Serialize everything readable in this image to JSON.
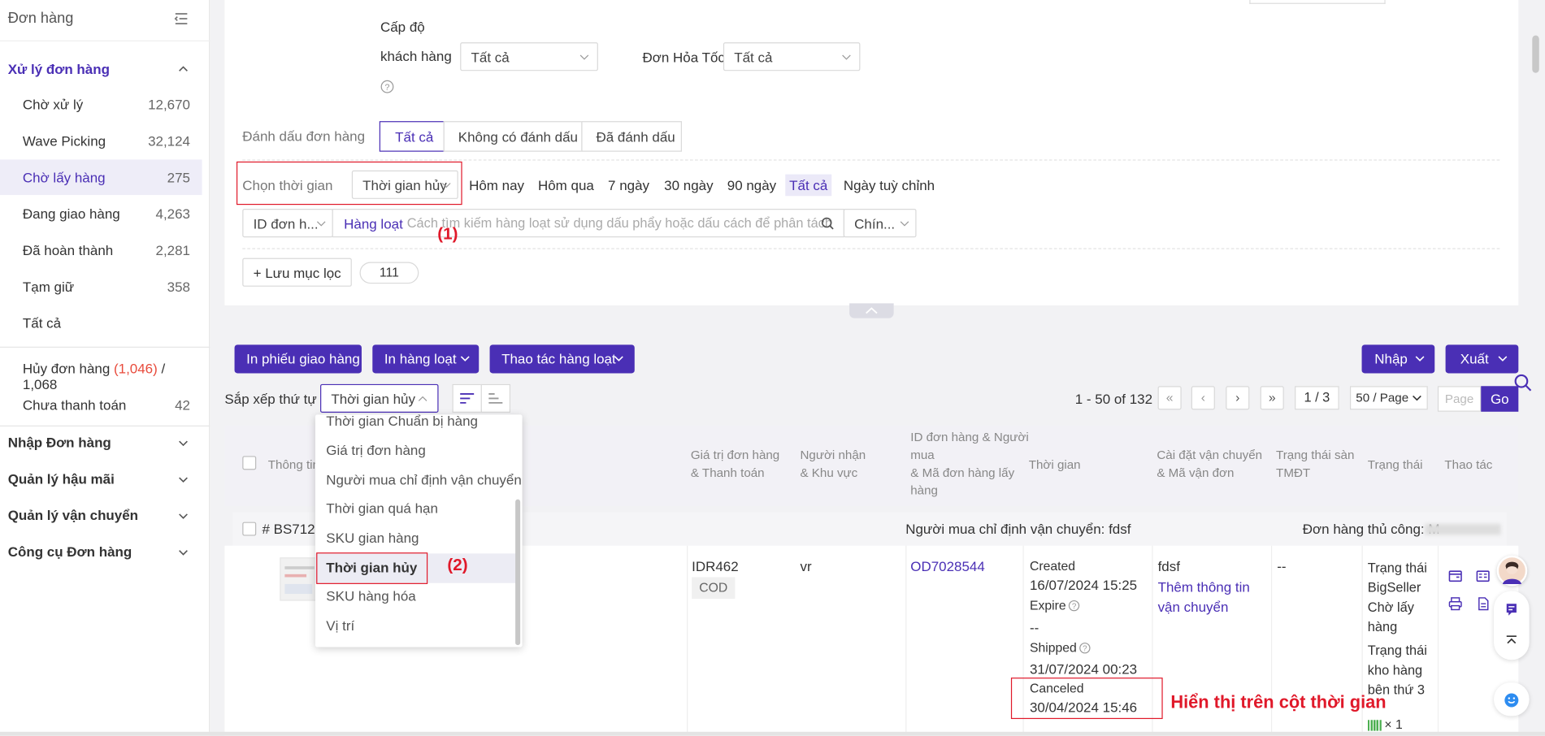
{
  "sidebar": {
    "title": "Đơn hàng",
    "group_process": "Xử lý đơn hàng",
    "items": [
      {
        "label": "Chờ xử lý",
        "count": "12,670"
      },
      {
        "label": "Wave Picking",
        "count": "32,124"
      },
      {
        "label": "Chờ lấy hàng",
        "count": "275"
      },
      {
        "label": "Đang giao hàng",
        "count": "4,263"
      },
      {
        "label": "Đã hoàn thành",
        "count": "2,281"
      },
      {
        "label": "Tạm giữ",
        "count": "358"
      },
      {
        "label": "Tất cả",
        "count": ""
      }
    ],
    "cancel_label": "Hủy đơn hàng",
    "cancel_count_red": "(1,046)",
    "cancel_count_total": "/ 1,068",
    "unpaid_label": "Chưa thanh toán",
    "unpaid_count": "42",
    "groups": [
      "Nhập Đơn hàng",
      "Quản lý hậu mãi",
      "Quản lý vận chuyển",
      "Công cụ Đơn hàng"
    ]
  },
  "filters": {
    "customer_level_line1": "Cấp độ",
    "customer_level_line2": "khách hàng",
    "customer_level_value": "Tất cả",
    "express_label": "Đơn Hỏa Tốc",
    "express_value": "Tất cả",
    "mark_label": "Đánh dấu đơn hàng",
    "mark_options": [
      "Tất cả",
      "Không có đánh dấu",
      "Đã đánh dấu"
    ],
    "time_label": "Chọn thời gian",
    "time_value": "Thời gian hủy",
    "quick_times": [
      "Hôm nay",
      "Hôm qua",
      "7 ngày",
      "30 ngày",
      "90 ngày",
      "Tất cả",
      "Ngày tuỳ chỉnh"
    ],
    "search_type": "ID đơn h...",
    "batch_label": "Hàng loạt",
    "search_placeholder": "Cách tìm kiếm hàng loạt sử dụng dấu phẩy hoặc dấu cách để phân tách",
    "exact_value": "Chín...",
    "save_filter": "+ Lưu mục lọc",
    "saved_tag": "111"
  },
  "annotations": {
    "a1": "(1)",
    "a2": "(2)",
    "a3": "Hiển thị trên cột thời gian"
  },
  "actions": {
    "print_delivery": "In phiếu giao hàng",
    "bulk_print": "In hàng loạt",
    "bulk_ops": "Thao tác hàng loạt",
    "import": "Nhập",
    "export": "Xuất"
  },
  "sort": {
    "label": "Sắp xếp thứ tự",
    "value": "Thời gian hủy",
    "options": [
      "Thời gian Chuẩn bị hàng",
      "Giá trị đơn hàng",
      "Người mua chỉ định vận chuyển",
      "Thời gian quá hạn",
      "SKU gian hàng",
      "Thời gian hủy",
      "SKU hàng hóa",
      "Vị trí"
    ],
    "selected_index": 5
  },
  "pagination": {
    "range": "1 - 50 of 132",
    "page": "1 / 3",
    "per_page": "50 / Page",
    "page_placeholder": "Page",
    "go": "Go"
  },
  "table": {
    "headers": {
      "product": "Thông tin",
      "value": [
        "Giá trị đơn hàng",
        "& Thanh toán"
      ],
      "recipient": [
        "Người nhận",
        "& Khu vực"
      ],
      "order_id": [
        "ID đơn hàng & Người",
        "mua",
        "& Mã đơn hàng lấy",
        "hàng"
      ],
      "time": "Thời gian",
      "shipping": [
        "Cài đặt vận chuyển",
        "& Mã vận đơn"
      ],
      "platform_status": [
        "Trạng thái sàn",
        "TMĐT"
      ],
      "status": "Trạng thái",
      "actions": "Thao tác"
    },
    "band": {
      "order_no": "# BS7120",
      "shipping_note": "Người mua chỉ định vận chuyển: fdsf",
      "manual_order": "Đơn hàng thủ công: M"
    },
    "row": {
      "amount": "IDR462",
      "payment": "COD",
      "recipient": "vr",
      "order_id": "OD7028544",
      "created_label": "Created",
      "created": "16/07/2024 15:25",
      "expire_label": "Expire",
      "expire": "--",
      "shipped_label": "Shipped",
      "shipped": "31/07/2024 00:23",
      "canceled_label": "Canceled",
      "canceled": "30/04/2024 15:46",
      "carrier": "fdsf",
      "add_shipping": [
        "Thêm thông tin",
        "vận chuyển"
      ],
      "platform_status": "--",
      "status_lines": [
        "Trạng thái",
        "BigSeller",
        "Chờ lấy",
        "hàng",
        "Trạng thái",
        "kho hàng",
        "bên thứ 3"
      ],
      "qty": "× 1"
    }
  },
  "colors": {
    "primary": "#4a2fb5",
    "annotation_red": "#e0192a",
    "cancel_red": "#e84b3c"
  }
}
